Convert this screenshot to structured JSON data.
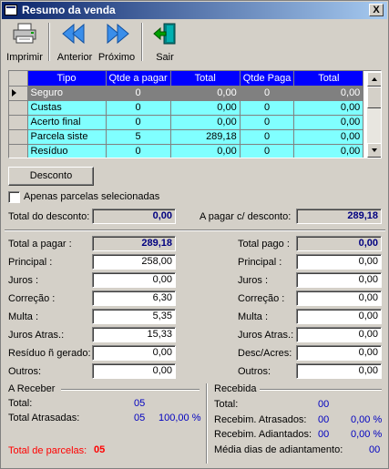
{
  "window": {
    "title": "Resumo da venda",
    "close_label": "X"
  },
  "toolbar": {
    "print_label": "Imprimir",
    "prev_label": "Anterior",
    "next_label": "Próximo",
    "exit_label": "Sair"
  },
  "grid": {
    "columns": [
      "Tipo",
      "Qtde a pagar",
      "Total",
      "Qtde Paga",
      "Total"
    ],
    "rows": [
      [
        "Seguro",
        "0",
        "0,00",
        "0",
        "0,00"
      ],
      [
        "Custas",
        "0",
        "0,00",
        "0",
        "0,00"
      ],
      [
        "Acerto final",
        "0",
        "0,00",
        "0",
        "0,00"
      ],
      [
        "Parcela siste",
        "5",
        "289,18",
        "0",
        "0,00"
      ],
      [
        "Resíduo",
        "0",
        "0,00",
        "0",
        "0,00"
      ]
    ]
  },
  "discount": {
    "button_label": "Desconto",
    "only_selected_label": "Apenas parcelas selecionadas",
    "total_discount_label": "Total do desconto:",
    "total_discount_value": "0,00",
    "to_pay_label": "A pagar c/ desconto:",
    "to_pay_value": "289,18"
  },
  "left": {
    "total_label": "Total a pagar :",
    "total_value": "289,18",
    "fields": [
      {
        "label": "Principal :",
        "value": "258,00"
      },
      {
        "label": "Juros :",
        "value": "0,00"
      },
      {
        "label": "Correção :",
        "value": "6,30"
      },
      {
        "label": "Multa :",
        "value": "5,35"
      },
      {
        "label": "Juros Atras.:",
        "value": "15,33"
      },
      {
        "label": "Resíduo ñ gerado:",
        "value": "0,00"
      },
      {
        "label": "Outros:",
        "value": "0,00"
      }
    ]
  },
  "right": {
    "total_label": "Total pago :",
    "total_value": "0,00",
    "fields": [
      {
        "label": "Principal :",
        "value": "0,00"
      },
      {
        "label": "Juros :",
        "value": "0,00"
      },
      {
        "label": "Correção :",
        "value": "0,00"
      },
      {
        "label": "Multa :",
        "value": "0,00"
      },
      {
        "label": "Juros Atras.:",
        "value": "0,00"
      },
      {
        "label": "Desc/Acres:",
        "value": "0,00"
      },
      {
        "label": "Outros:",
        "value": "0,00"
      }
    ]
  },
  "a_receber": {
    "title": "A Receber",
    "total_label": "Total:",
    "total_value": "05",
    "atrasadas_label": "Total Atrasadas:",
    "atrasadas_value": "05",
    "atrasadas_pct": "100,00 %",
    "parcelas_label": "Total de parcelas:",
    "parcelas_value": "05"
  },
  "recebida": {
    "title": "Recebida",
    "total_label": "Total:",
    "total_value": "00",
    "atrasados_label": "Recebim. Atrasados:",
    "atrasados_value": "00",
    "atrasados_pct": "0,00 %",
    "adiantados_label": "Recebim. Adiantados:",
    "adiantados_value": "00",
    "adiantados_pct": "0,00 %",
    "media_label": "Média dias de adiantamento:",
    "media_value": "00"
  },
  "colors": {
    "titlebar": "#0a246a",
    "header": "#0000ff",
    "row": "#80ffff",
    "selected_row": "#808080",
    "value_text": "#0000c0",
    "alert_text": "#ff0000"
  }
}
